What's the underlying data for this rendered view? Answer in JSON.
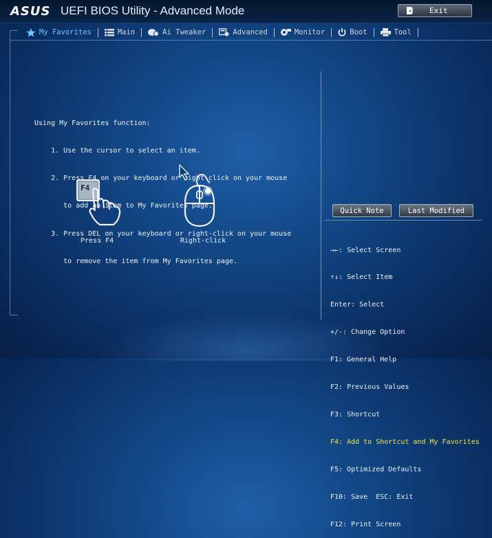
{
  "titlebar": {
    "logo": "ASUS",
    "title": "UEFI BIOS Utility - Advanced Mode",
    "exit_label": "Exit"
  },
  "tabs": [
    {
      "label": "My Favorites",
      "icon": "star-icon",
      "active": true
    },
    {
      "label": "Main",
      "icon": "list-icon",
      "active": false
    },
    {
      "label": "Ai Tweaker",
      "icon": "tweaker-icon",
      "active": false
    },
    {
      "label": "Advanced",
      "icon": "advanced-icon",
      "active": false
    },
    {
      "label": "Monitor",
      "icon": "monitor-icon",
      "active": false
    },
    {
      "label": "Boot",
      "icon": "power-icon",
      "active": false
    },
    {
      "label": "Tool",
      "icon": "printer-icon",
      "active": false
    }
  ],
  "instructions": {
    "title": "Using My Favorites function:",
    "lines": [
      "    1. Use the cursor to select an item.",
      "    2. Press F4 on your keyboard or right-click on your mouse",
      "       to add an item to My Favorites page.",
      "    3. Press DEL on your keyboard or right-click on your mouse",
      "       to remove the item from My Favorites page."
    ]
  },
  "illustrations": {
    "key_label": "F4",
    "press_caption": "Press F4",
    "click_caption": "Right-click"
  },
  "right_panel": {
    "quick_note": "Quick Note",
    "last_modified": "Last Modified",
    "help": [
      "→←: Select Screen",
      "↑↓: Select Item",
      "Enter: Select",
      "+/-: Change Option",
      "F1: General Help",
      "F2: Previous Values",
      "F3: Shortcut",
      "F4: Add to Shortcut and My Favorites",
      "F5: Optimized Defaults",
      "F10: Save  ESC: Exit",
      "F12: Print Screen"
    ],
    "highlight_index": 7,
    "highlight_color": "#f3e64a"
  },
  "colors": {
    "accent": "#6cc8ff",
    "background": "#114482"
  }
}
